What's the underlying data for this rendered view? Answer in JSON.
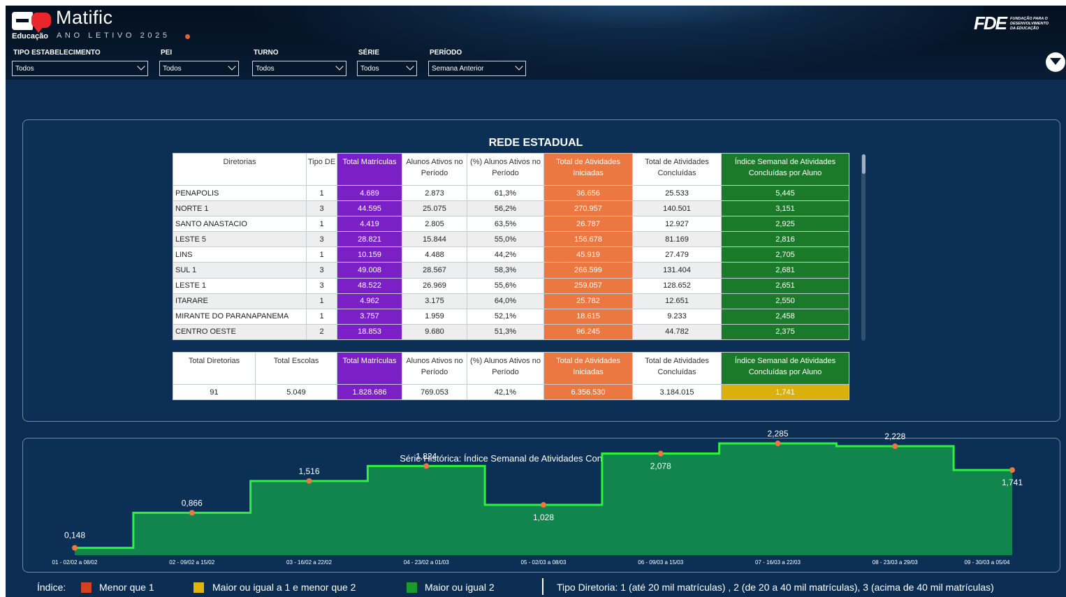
{
  "header": {
    "brand": "Matific",
    "brand_sub": "Educação",
    "year_label": "ANO LETIVO 2025",
    "fde_mark": "FDE",
    "fde_lines": [
      "FUNDAÇÃO PARA O",
      "DESENVOLVIMENTO",
      "DA EDUCAÇÃO"
    ],
    "filters": [
      {
        "label": "TIPO ESTABELECIMENTO",
        "value": "Todos"
      },
      {
        "label": "PEI",
        "value": "Todos"
      },
      {
        "label": "TURNO",
        "value": "Todos"
      },
      {
        "label": "SÉRIE",
        "value": "Todos"
      },
      {
        "label": "PERÍODO",
        "value": "Semana Anterior"
      }
    ]
  },
  "rede": {
    "title": "REDE ESTADUAL",
    "columns": [
      "Diretorias",
      "Tipo DE",
      "Total Matrículas",
      "Alunos Ativos no Período",
      "(%) Alunos Ativos no Período",
      "Total de Atividades Iniciadas",
      "Total de Atividades Concluídas",
      "Índice Semanal de Atividades Concluídas por Aluno"
    ],
    "rows": [
      [
        "PENAPOLIS",
        "1",
        "4.689",
        "2.873",
        "61,3%",
        "36.656",
        "25.533",
        "5,445"
      ],
      [
        "NORTE 1",
        "3",
        "44.595",
        "25.075",
        "56,2%",
        "270.957",
        "140.501",
        "3,151"
      ],
      [
        "SANTO ANASTACIO",
        "1",
        "4.419",
        "2.805",
        "63,5%",
        "26.787",
        "12.927",
        "2,925"
      ],
      [
        "LESTE 5",
        "3",
        "28.821",
        "15.844",
        "55,0%",
        "156.678",
        "81.169",
        "2,816"
      ],
      [
        "LINS",
        "1",
        "10.159",
        "4.488",
        "44,2%",
        "45.919",
        "27.479",
        "2,705"
      ],
      [
        "SUL 1",
        "3",
        "49.008",
        "28.567",
        "58,3%",
        "266.599",
        "131.404",
        "2,681"
      ],
      [
        "LESTE 1",
        "3",
        "48.522",
        "26.969",
        "55,6%",
        "259.057",
        "128.652",
        "2,651"
      ],
      [
        "ITARARE",
        "1",
        "4.962",
        "3.175",
        "64,0%",
        "25.782",
        "12.651",
        "2,550"
      ],
      [
        "MIRANTE DO PARANAPANEMA",
        "1",
        "3.757",
        "1.959",
        "52,1%",
        "18.615",
        "9.233",
        "2,458"
      ],
      [
        "CENTRO OESTE",
        "2",
        "18.853",
        "9.680",
        "51,3%",
        "96.245",
        "44.782",
        "2,375"
      ]
    ],
    "totals_columns": [
      "Total Diretorias",
      "Total Escolas",
      "Total Matrículas",
      "Alunos Ativos no Período",
      "(%) Alunos Ativos no Período",
      "Total de Atividades Iniciadas",
      "Total de Atividades Concluídas",
      "Índice Semanal de Atividades Concluídas por Aluno"
    ],
    "totals": [
      "91",
      "5.049",
      "1.828.686",
      "769.053",
      "42,1%",
      "6.356.530",
      "3.184.015",
      "1,741"
    ]
  },
  "chart_data": {
    "type": "area",
    "title": "Série Histórica: Índice Semanal de Atividades Concluídas por Aluno",
    "categories": [
      "01 - 02/02 a 08/02",
      "02 - 09/02 a 15/02",
      "03 - 16/02 a 22/02",
      "04 - 23/02 a 01/03",
      "05 - 02/03 a 08/03",
      "06 - 09/03 a 15/03",
      "07 - 16/03 a 22/03",
      "08 - 23/03 a 29/03",
      "09 - 30/03 a 05/04"
    ],
    "values": [
      0.148,
      0.866,
      1.516,
      1.824,
      1.028,
      2.078,
      2.285,
      2.228,
      1.741
    ],
    "value_labels": [
      "0,148",
      "0,866",
      "1,516",
      "1,824",
      "1,028",
      "2,078",
      "2,285",
      "2,228",
      "1,741"
    ],
    "ylim": [
      0,
      2.5
    ],
    "step": "mid",
    "colors": {
      "fill": "#12844d",
      "line": "#2df03f",
      "marker": "#ec7841"
    }
  },
  "legend": {
    "label": "Índice:",
    "items": [
      {
        "text": "Menor que 1",
        "color": "#d2421e"
      },
      {
        "text": "Maior ou igual a 1 e menor que 2",
        "color": "#e2b40f"
      },
      {
        "text": "Maior ou igual 2",
        "color": "#1b9a2e"
      }
    ],
    "tipo": "Tipo Diretoria: 1 (até 20 mil matrículas) , 2 (de 20 a 40 mil matrículas), 3 (acima de 40 mil matrículas)"
  }
}
